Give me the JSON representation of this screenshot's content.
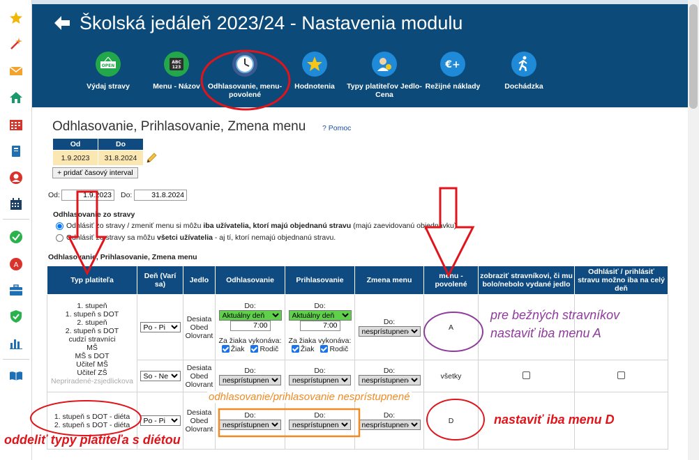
{
  "header": {
    "title": "Školská jedáleň 2023/24 - Nastavenia modulu",
    "tools": [
      {
        "icon": "open-sign-icon",
        "label": "Výdaj stravy"
      },
      {
        "icon": "abc-123-icon",
        "label": "Menu - Názov"
      },
      {
        "icon": "clock-icon",
        "label": "Odhlasovanie, menu-povolené"
      },
      {
        "icon": "star-icon",
        "label": "Hodnotenia"
      },
      {
        "icon": "person-price-icon",
        "label": "Typy platiteľov Jedlo-Cena"
      },
      {
        "icon": "euro-plus-icon",
        "label": "Režijné náklady"
      },
      {
        "icon": "walking-person-icon",
        "label": "Dochádzka"
      }
    ]
  },
  "sidebar": {
    "icons": [
      "star-icon",
      "magic-wand-icon",
      "envelope-icon",
      "home-icon",
      "calendar-grid-icon",
      "book-icon",
      "user-circle-icon",
      "calendar-icon",
      "check-circle-icon",
      "no-entry-icon",
      "briefcase-icon",
      "shield-check-icon",
      "bar-chart-icon",
      "open-book-icon"
    ]
  },
  "section": {
    "title": "Odhlasovanie, Prihlasovanie, Zmena menu",
    "help": "? Pomoc"
  },
  "interval": {
    "headers": [
      "Od",
      "Do"
    ],
    "from": "1.9.2023",
    "to": "31.8.2024",
    "add_button": "+ pridať časový interval"
  },
  "filter": {
    "from_label": "Od:",
    "from_value": "1.9.2023",
    "to_label": "Do:",
    "to_value": "31.8.2024"
  },
  "radio_group": {
    "title": "Odhlasovanie zo stravy",
    "option1_prefix": "Odhlásiť zo stravy / zmeniť menu si môžu ",
    "option1_bold": "iba užívatelia, ktorí majú objednanú stravu",
    "option1_suffix": " (majú zaevidovanú objednávku)",
    "option2_prefix": "Odhlásiť zo stravy sa môžu ",
    "option2_bold": "všetci užívatelia",
    "option2_suffix": " - aj tí, ktorí nemajú objednanú stravu."
  },
  "table": {
    "title": "Odhlasovanie, Prihlasovanie, Zmena menu",
    "headers": [
      "Typ platiteľa",
      "Deň (Varí sa)",
      "Jedlo",
      "Odhlasovanie",
      "Prihlasovanie",
      "Zmena menu",
      "menu - povolené",
      "zobraziť stravníkovi, či mu bolo/nebolo vydané jedlo",
      "Odhlásiť / prihlásiť stravu možno iba na celý deň"
    ],
    "group1": {
      "payers": [
        "1. stupeň",
        "1. stupeň s DOT",
        "2. stupeň",
        "2. stupeň s DOT",
        "cudzí stravníci",
        "MŠ",
        "MŠ s DOT",
        "Učiteľ MŠ",
        "Učiteľ ZŠ"
      ],
      "payers_muted": "Nepriradené-zsjedlickova",
      "row1": {
        "day": "Po - Pi",
        "food": [
          "Desiata",
          "Obed",
          "Olovrant"
        ],
        "do_label": "Do:",
        "logout_day": "Aktuálny deň",
        "logout_time": "7:00",
        "performs_label": "Za žiaka vykonáva:",
        "pupil": "Žiak",
        "parent": "Rodič",
        "login_day": "Aktuálny deň",
        "login_time": "7:00",
        "change_value": "nesprístupnené",
        "menu_allowed": "A"
      },
      "row2": {
        "day": "So - Ne",
        "food": [
          "Desiata",
          "Obed",
          "Olovrant"
        ],
        "do_label": "Do:",
        "logout_value": "nesprístupnené",
        "login_value": "nesprístupnené",
        "change_value": "nesprístupnené",
        "menu_allowed": "všetky"
      }
    },
    "group2": {
      "payers": [
        "1. stupeň s DOT - diéta",
        "2. stupeň s DOT - diéta"
      ],
      "day": "Po - Pi",
      "food": [
        "Desiata",
        "Obed",
        "Olovrant"
      ],
      "do_label": "Do:",
      "logout_value": "nesprístupnené",
      "login_value": "nesprístupnené",
      "change_value": "nesprístupnené",
      "menu_allowed": "D"
    }
  },
  "annotations": {
    "regular_line1": "pre bežných stravníkov",
    "regular_line2": "nastaviť iba menu A",
    "unavailable": "odhlasovanie/prihlasovanie nesprístupnené",
    "menu_d": "nastaviť iba menu D",
    "separate": "oddeliť typy platiteľa s diétou"
  },
  "colors": {
    "header": "#0c4a79",
    "table_header": "#0f4b80",
    "interval_cell": "#fbe7b2",
    "annotation_red": "#e0141a",
    "annotation_purple": "#8e3b9c",
    "annotation_orange": "#f08a24"
  }
}
